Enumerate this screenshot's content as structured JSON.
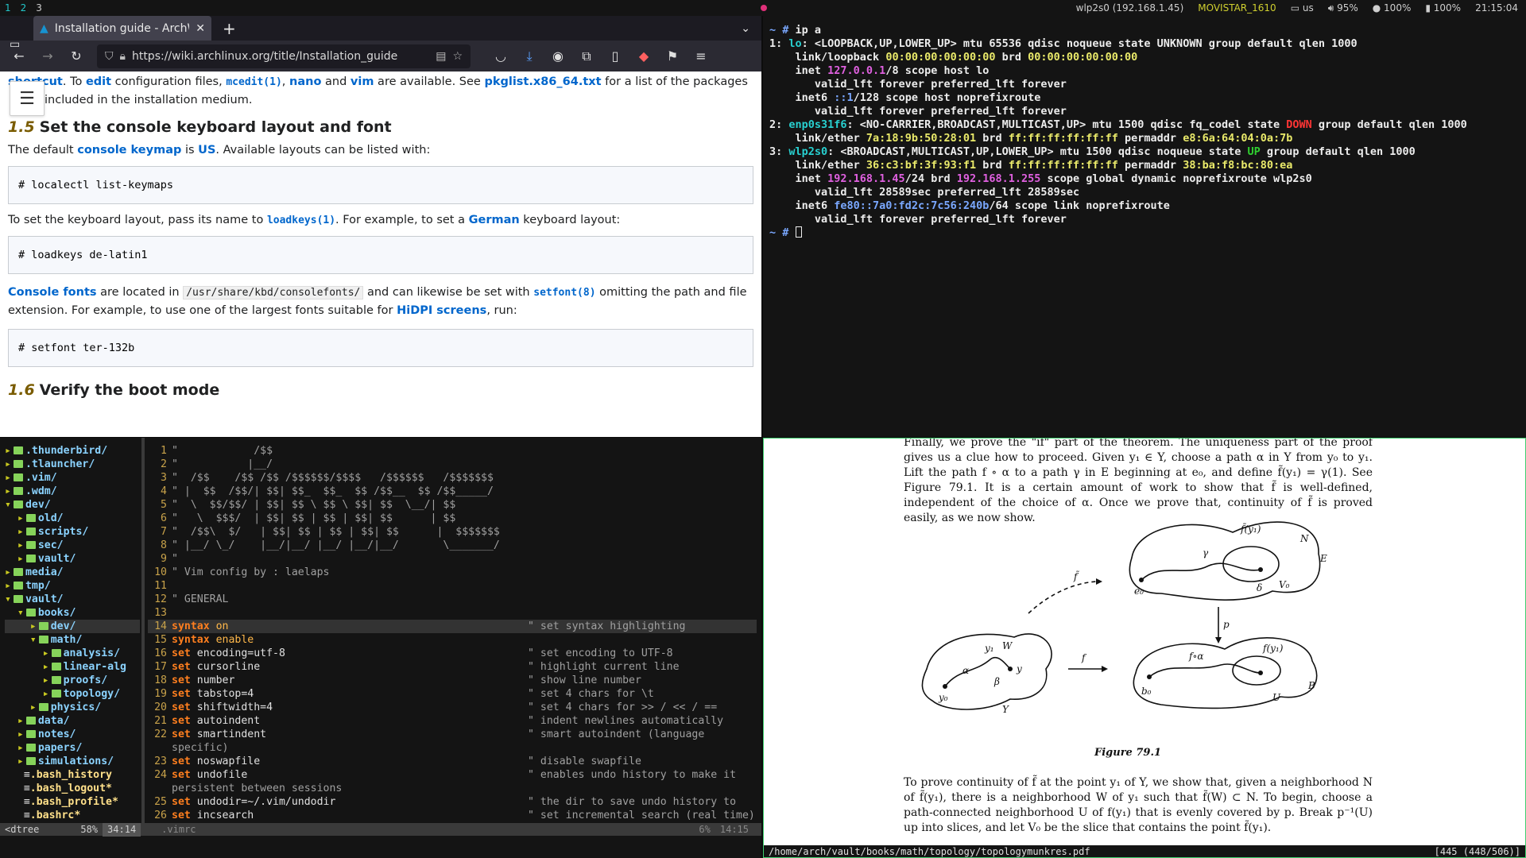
{
  "topbar": {
    "workspaces": [
      "1",
      "2",
      "3"
    ],
    "wifi": "wlp2s0 (192.168.1.45)",
    "ssid": "MOVISTAR_1610",
    "layout": "us",
    "volume": "95%",
    "brightness": "100%",
    "battery": "100%",
    "time": "21:15:04"
  },
  "browser": {
    "tab_title": "Installation guide - ArchW",
    "url": "https://wiki.archlinux.org/title/Installation_guide",
    "intro_line1_a": "shortcut",
    "intro_line1_b": ". To ",
    "intro_line1_c": "edit",
    "intro_line1_d": " configuration files, ",
    "intro_line1_e": "mcedit(1)",
    "intro_line1_f": ", ",
    "intro_line1_g": "nano",
    "intro_line1_h": " and ",
    "intro_line1_i": "vim",
    "intro_line1_j": " are available. See ",
    "intro_line1_k": "pkglist.x86_64.txt",
    "intro_line1_l": " for a list of the packages",
    "intro_line2": "included in the installation medium.",
    "section15_num": "1.5",
    "section15_title": "Set the console keyboard layout and font",
    "p1_a": "The default ",
    "p1_b": "console keymap",
    "p1_c": " is ",
    "p1_d": "US",
    "p1_e": ". Available layouts can be listed with:",
    "code1": "# localectl list-keymaps",
    "p2_a": "To set the keyboard layout, pass its name to ",
    "p2_b": "loadkeys(1)",
    "p2_c": ". For example, to set a ",
    "p2_d": "German",
    "p2_e": " keyboard layout:",
    "code2": "# loadkeys de-latin1",
    "p3_a": "Console fonts",
    "p3_b": " are located in ",
    "p3_c": "/usr/share/kbd/consolefonts/",
    "p3_d": " and can likewise be set with ",
    "p3_e": "setfont(8)",
    "p3_f": " omitting the path and file",
    "p3_g": "extension. For example, to use one of the largest fonts suitable for ",
    "p3_h": "HiDPI screens",
    "p3_i": ", run:",
    "code3": "# setfont ter-132b",
    "section16_num": "1.6",
    "section16_title": "Verify the boot mode"
  },
  "terminal": {
    "prompt": "~ #",
    "command": "ip a"
  },
  "vim": {
    "tree": [
      {
        "arrow": "▸",
        "indent": 0,
        "name": ".thunderbird/"
      },
      {
        "arrow": "▸",
        "indent": 0,
        "name": ".tlauncher/"
      },
      {
        "arrow": "▸",
        "indent": 0,
        "name": ".vim/"
      },
      {
        "arrow": "▸",
        "indent": 0,
        "name": ".wdm/"
      },
      {
        "arrow": "▾",
        "indent": 0,
        "name": "dev/"
      },
      {
        "arrow": "▸",
        "indent": 1,
        "name": "old/"
      },
      {
        "arrow": "▸",
        "indent": 1,
        "name": "scripts/"
      },
      {
        "arrow": "▸",
        "indent": 1,
        "name": "sec/"
      },
      {
        "arrow": "▸",
        "indent": 1,
        "name": "vault/"
      },
      {
        "arrow": "▸",
        "indent": 0,
        "name": "media/"
      },
      {
        "arrow": "▸",
        "indent": 0,
        "name": "tmp/"
      },
      {
        "arrow": "▾",
        "indent": 0,
        "name": "vault/"
      },
      {
        "arrow": "▾",
        "indent": 1,
        "name": "books/"
      },
      {
        "arrow": "▸",
        "indent": 2,
        "name": "dev/"
      },
      {
        "arrow": "▾",
        "indent": 2,
        "name": "math/"
      },
      {
        "arrow": "▸",
        "indent": 3,
        "name": "analysis/"
      },
      {
        "arrow": "▸",
        "indent": 3,
        "name": "linear-alg"
      },
      {
        "arrow": "▸",
        "indent": 3,
        "name": "proofs/"
      },
      {
        "arrow": "▸",
        "indent": 3,
        "name": "topology/"
      },
      {
        "arrow": "▸",
        "indent": 2,
        "name": "physics/"
      },
      {
        "arrow": "▸",
        "indent": 1,
        "name": "data/"
      },
      {
        "arrow": "▸",
        "indent": 1,
        "name": "notes/"
      },
      {
        "arrow": "▸",
        "indent": 1,
        "name": "papers/"
      },
      {
        "arrow": "▸",
        "indent": 1,
        "name": "simulations/"
      },
      {
        "arrow": "",
        "indent": 1,
        "name": ".bash_history",
        "file": true
      },
      {
        "arrow": "",
        "indent": 1,
        "name": ".bash_logout*",
        "file": true
      },
      {
        "arrow": "",
        "indent": 1,
        "name": ".bash_profile*",
        "file": true
      },
      {
        "arrow": "",
        "indent": 1,
        "name": ".bashrc*",
        "file": true
      }
    ],
    "status_left": "<dtree",
    "status_pct": "58%",
    "status_pos": "34:14",
    "status_file": ".vimrc",
    "status_right_pct": "6%",
    "status_right_pos": "14:15"
  },
  "pdf": {
    "para1": "Finally, we prove the \"if\" part of the theorem. The uniqueness part of the proof gives us a clue how to proceed. Given y₁ ∈ Y, choose a path α in Y from y₀ to y₁. Lift the path f ∘ α to a path γ in E beginning at e₀, and define f̃(y₁) = γ(1). See Figure 79.1. It is a certain amount of work to show that f̃ is well-defined, independent of the choice of α. Once we prove that, continuity of f̃ is proved easily, as we now show.",
    "caption": "Figure 79.1",
    "para2": "To prove continuity of f̃ at the point y₁ of Y, we show that, given a neighborhood N of f̃(y₁), there is a neighborhood W of y₁ such that f̃(W) ⊂ N. To begin, choose a path-connected neighborhood U of f(y₁) that is evenly covered by p. Break p⁻¹(U) up into slices, and let V₀ be the slice that contains the point f̃(y₁).",
    "fig_labels": {
      "ftilde_y1": "f̃(y₁)",
      "N": "N",
      "E": "E",
      "gamma": "γ",
      "e0": "e₀",
      "delta": "δ",
      "V0": "V₀",
      "ftilde": "f̃",
      "p": "p",
      "y1": "y₁",
      "W": "W",
      "alpha": "α",
      "beta": "β",
      "y": "y",
      "y0": "y₀",
      "Y": "Y",
      "f": "f",
      "foalpha": "f∘α",
      "fy1": "f(y₁)",
      "b0": "b₀",
      "U": "U",
      "B": "B"
    },
    "status_path": "/home/arch/vault/books/math/topology/topologymunkres.pdf",
    "status_page": "[445 (448/506)]"
  }
}
